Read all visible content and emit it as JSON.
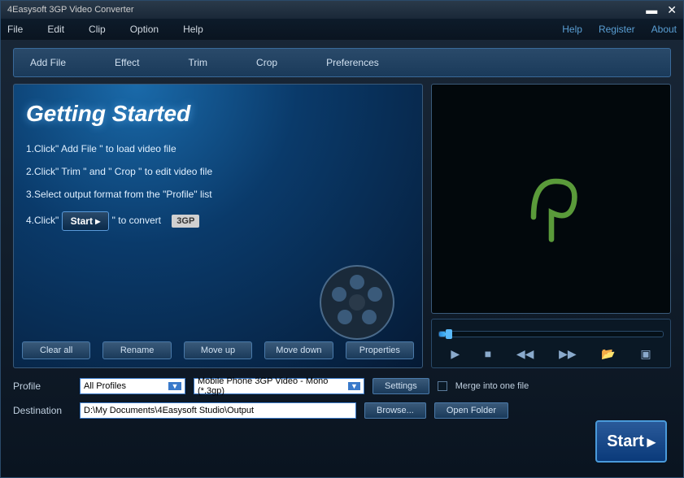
{
  "title": "4Easysoft 3GP Video Converter",
  "menu": {
    "file": "File",
    "edit": "Edit",
    "clip": "Clip",
    "option": "Option",
    "help": "Help"
  },
  "menuRight": {
    "help": "Help",
    "register": "Register",
    "about": "About"
  },
  "toolbar": {
    "addfile": "Add File",
    "effect": "Effect",
    "trim": "Trim",
    "crop": "Crop",
    "preferences": "Preferences"
  },
  "gs": {
    "title": "Getting Started",
    "step1": "1.Click\" Add File \" to load video file",
    "step2": "2.Click\" Trim \" and \" Crop \" to edit video file",
    "step3": "3.Select output format from the \"Profile\" list",
    "step4a": "4.Click\"",
    "step4start": "Start ▸",
    "step4b": "\" to convert",
    "badge3gp": "3GP"
  },
  "actions": {
    "clear": "Clear all",
    "rename": "Rename",
    "moveup": "Move up",
    "movedown": "Move down",
    "properties": "Properties"
  },
  "profile": {
    "label": "Profile",
    "all": "All Profiles",
    "format": "Mobile Phone 3GP Video - Mono (*.3gp)",
    "settings": "Settings",
    "merge": "Merge into one file"
  },
  "dest": {
    "label": "Destination",
    "path": "D:\\My Documents\\4Easysoft Studio\\Output",
    "browse": "Browse...",
    "open": "Open Folder"
  },
  "start": "Start"
}
